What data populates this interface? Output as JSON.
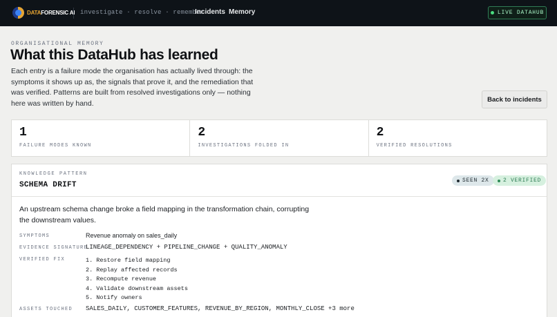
{
  "brand": {
    "logo_part1": "DATA",
    "logo_part2": "FORENSIC AI"
  },
  "topbar": {
    "tagline": "investigate · resolve · remember",
    "nav": [
      "Incidents",
      "Memory"
    ],
    "live_label": "LIVE DATAHUB"
  },
  "header": {
    "eyebrow": "ORGANISATIONAL MEMORY",
    "title": "What this DataHub has learned",
    "intro": "Each entry is a failure mode the organisation has actually lived through: the symptoms it shows up as, the signals that prove it, and the remediation that was verified. Patterns are built from resolved investigations only — nothing here was written by hand.",
    "back_button": "Back to incidents"
  },
  "stats": [
    {
      "value": "1",
      "label": "FAILURE MODES KNOWN"
    },
    {
      "value": "2",
      "label": "INVESTIGATIONS FOLDED IN"
    },
    {
      "value": "2",
      "label": "VERIFIED RESOLUTIONS"
    }
  ],
  "pattern": {
    "eyebrow": "KNOWLEDGE PATTERN",
    "title": "SCHEMA DRIFT",
    "badge_seen": "SEEN 2X",
    "badge_verified": "2 VERIFIED",
    "description": "An upstream schema change broke a field mapping in the transformation chain, corrupting the downstream values.",
    "symptoms_label": "SYMPTOMS",
    "symptoms": "Revenue anomaly on sales_daily",
    "signature_label": "EVIDENCE SIGNATURE",
    "signature": "LINEAGE_DEPENDENCY + PIPELINE_CHANGE + QUALITY_ANOMALY",
    "fix_label": "VERIFIED FIX",
    "fix_steps": [
      "1. Restore field mapping",
      "2. Replay affected records",
      "3. Recompute revenue",
      "4. Validate downstream assets",
      "5. Notify owners"
    ],
    "assets_label": "ASSETS TOUCHED",
    "assets": "SALES_DAILY, CUSTOMER_FEATURES, REVENUE_BY_REGION, MONTHLY_CLOSE +3 more"
  },
  "colors": {
    "topbar_bg": "#0e1318",
    "page_bg": "#f0f0ee",
    "brand_accent": "#e6a532",
    "live_green": "#4ade80",
    "verified_green": "#2f7d55"
  }
}
